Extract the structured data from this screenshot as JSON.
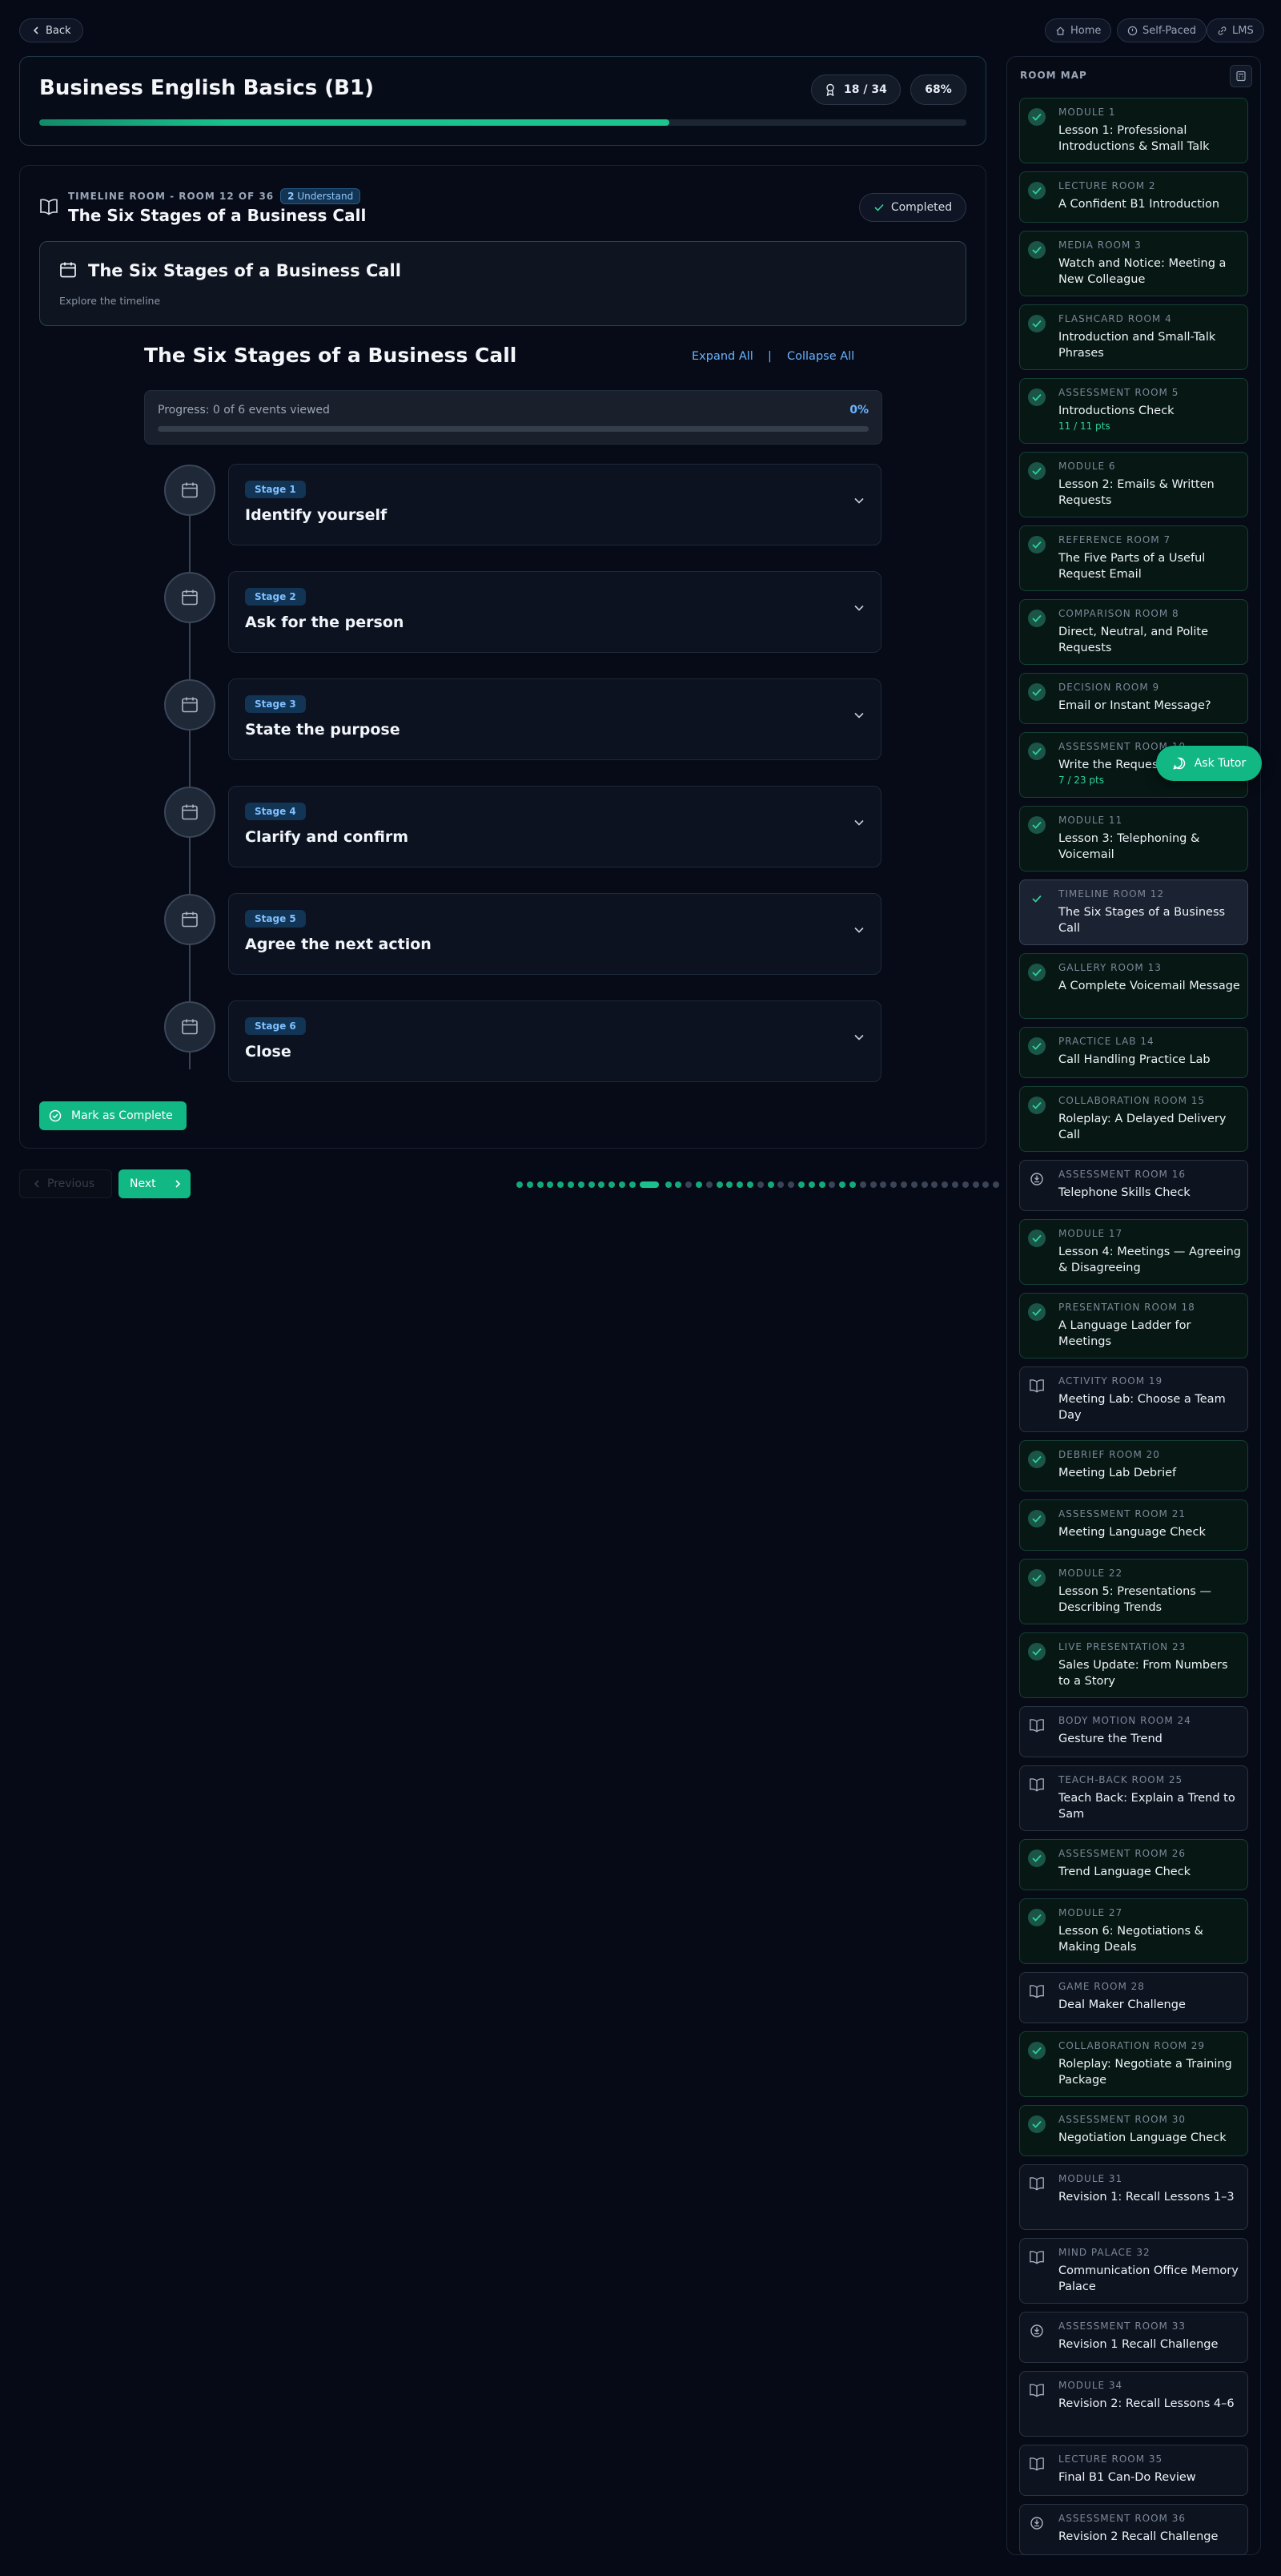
{
  "nav": {
    "back_label": "Back",
    "home_label": "Home",
    "self_paced_label": "Self-Paced",
    "lms_label": "LMS"
  },
  "course": {
    "title": "Business English Basics (B1)",
    "rooms_count": "18 / 34",
    "percent": "68%",
    "progress": 0.68
  },
  "room": {
    "meta": "TIMELINE ROOM - ROOM 12 OF 36",
    "badge_num": "2",
    "badge_label": "Understand",
    "title": "The Six Stages of a Business Call",
    "status": "Completed",
    "banner_title": "The Six Stages of a Business Call",
    "banner_sub": "Explore the timeline"
  },
  "timeline": {
    "heading": "The Six Stages of a Business Call",
    "expand_all": "Expand All",
    "separator": "|",
    "collapse_all": "Collapse All",
    "progress_text": "Progress: 0 of 6 events viewed",
    "progress_pct": "0%",
    "events": [
      {
        "badge": "Stage 1",
        "title": "Identify yourself"
      },
      {
        "badge": "Stage 2",
        "title": "Ask for the person"
      },
      {
        "badge": "Stage 3",
        "title": "State the purpose"
      },
      {
        "badge": "Stage 4",
        "title": "Clarify and confirm"
      },
      {
        "badge": "Stage 5",
        "title": "Agree the next action"
      },
      {
        "badge": "Stage 6",
        "title": "Close"
      }
    ]
  },
  "actions": {
    "mark_complete": "Mark as Complete",
    "previous": "Previous",
    "next": "Next"
  },
  "pager": {
    "total": 46,
    "current": 12,
    "done": [
      0,
      1,
      2,
      3,
      4,
      5,
      6,
      7,
      8,
      9,
      10,
      11,
      13,
      14,
      16,
      18,
      19,
      20,
      21,
      23,
      26,
      27,
      28,
      30,
      31
    ]
  },
  "tutor": {
    "label": "Ask Tutor"
  },
  "room_map": {
    "title": "ROOM MAP",
    "rooms": [
      {
        "cat": "MODULE 1",
        "title": "Lesson 1: Professional Introductions & Small Talk",
        "state": "done",
        "icon": "check"
      },
      {
        "cat": "LECTURE ROOM 2",
        "title": "A Confident B1 Introduction",
        "state": "done",
        "icon": "check"
      },
      {
        "cat": "MEDIA ROOM 3",
        "title": "Watch and Notice: Meeting a New Colleague",
        "state": "done",
        "icon": "check"
      },
      {
        "cat": "FLASHCARD ROOM 4",
        "title": "Introduction and Small-Talk Phrases",
        "state": "done",
        "icon": "check"
      },
      {
        "cat": "ASSESSMENT ROOM 5",
        "title": "Introductions Check",
        "sub": "11 / 11 pts",
        "state": "done",
        "icon": "check"
      },
      {
        "cat": "MODULE 6",
        "title": "Lesson 2: Emails & Written Requests",
        "state": "done",
        "icon": "check"
      },
      {
        "cat": "REFERENCE ROOM 7",
        "title": "The Five Parts of a Useful Request Email",
        "state": "done",
        "icon": "check"
      },
      {
        "cat": "COMPARISON ROOM 8",
        "title": "Direct, Neutral, and Polite Requests",
        "state": "done",
        "icon": "check"
      },
      {
        "cat": "DECISION ROOM 9",
        "title": "Email or Instant Message?",
        "state": "done",
        "icon": "check"
      },
      {
        "cat": "ASSESSMENT ROOM 10",
        "title": "Write the Request",
        "sub": "7 / 23 pts",
        "state": "done",
        "icon": "check"
      },
      {
        "cat": "MODULE 11",
        "title": "Lesson 3: Telephoning & Voicemail",
        "state": "done",
        "icon": "check"
      },
      {
        "cat": "TIMELINE ROOM 12",
        "title": "The Six Stages of a Business Call",
        "state": "active",
        "icon": "check"
      },
      {
        "cat": "GALLERY ROOM 13",
        "title": "A Complete Voicemail Message",
        "state": "done",
        "icon": "check"
      },
      {
        "cat": "PRACTICE LAB 14",
        "title": "Call Handling Practice Lab",
        "state": "done",
        "icon": "check"
      },
      {
        "cat": "COLLABORATION ROOM 15",
        "title": "Roleplay: A Delayed Delivery Call",
        "state": "done",
        "icon": "check"
      },
      {
        "cat": "ASSESSMENT ROOM 16",
        "title": "Telephone Skills Check",
        "state": "open",
        "icon": "assess"
      },
      {
        "cat": "MODULE 17",
        "title": "Lesson 4: Meetings — Agreeing & Disagreeing",
        "state": "done",
        "icon": "check"
      },
      {
        "cat": "PRESENTATION ROOM 18",
        "title": "A Language Ladder for Meetings",
        "state": "done",
        "icon": "check"
      },
      {
        "cat": "ACTIVITY ROOM 19",
        "title": "Meeting Lab: Choose a Team Day",
        "state": "open",
        "icon": "book"
      },
      {
        "cat": "DEBRIEF ROOM 20",
        "title": "Meeting Lab Debrief",
        "state": "done",
        "icon": "check"
      },
      {
        "cat": "ASSESSMENT ROOM 21",
        "title": "Meeting Language Check",
        "state": "done",
        "icon": "check"
      },
      {
        "cat": "MODULE 22",
        "title": "Lesson 5: Presentations — Describing Trends",
        "state": "done",
        "icon": "check"
      },
      {
        "cat": "LIVE PRESENTATION 23",
        "title": "Sales Update: From Numbers to a Story",
        "state": "done",
        "icon": "check"
      },
      {
        "cat": "BODY MOTION ROOM 24",
        "title": "Gesture the Trend",
        "state": "open",
        "icon": "book"
      },
      {
        "cat": "TEACH-BACK ROOM 25",
        "title": "Teach Back: Explain a Trend to Sam",
        "state": "open",
        "icon": "book"
      },
      {
        "cat": "ASSESSMENT ROOM 26",
        "title": "Trend Language Check",
        "state": "done",
        "icon": "check"
      },
      {
        "cat": "MODULE 27",
        "title": "Lesson 6: Negotiations & Making Deals",
        "state": "done",
        "icon": "check"
      },
      {
        "cat": "GAME ROOM 28",
        "title": "Deal Maker Challenge",
        "state": "open",
        "icon": "book"
      },
      {
        "cat": "COLLABORATION ROOM 29",
        "title": "Roleplay: Negotiate a Training Package",
        "state": "done",
        "icon": "check"
      },
      {
        "cat": "ASSESSMENT ROOM 30",
        "title": "Negotiation Language Check",
        "state": "done",
        "icon": "check"
      },
      {
        "cat": "MODULE 31",
        "title": "Revision 1: Recall Lessons 1–3",
        "state": "open",
        "icon": "book"
      },
      {
        "cat": "MIND PALACE 32",
        "title": "Communication Office Memory Palace",
        "state": "open",
        "icon": "book"
      },
      {
        "cat": "ASSESSMENT ROOM 33",
        "title": "Revision 1 Recall Challenge",
        "state": "open",
        "icon": "assess"
      },
      {
        "cat": "MODULE 34",
        "title": "Revision 2: Recall Lessons 4–6",
        "state": "open",
        "icon": "book"
      },
      {
        "cat": "LECTURE ROOM 35",
        "title": "Final B1 Can-Do Review",
        "state": "open",
        "icon": "book"
      },
      {
        "cat": "ASSESSMENT ROOM 36",
        "title": "Revision 2 Recall Challenge",
        "state": "open",
        "icon": "assess"
      }
    ]
  }
}
